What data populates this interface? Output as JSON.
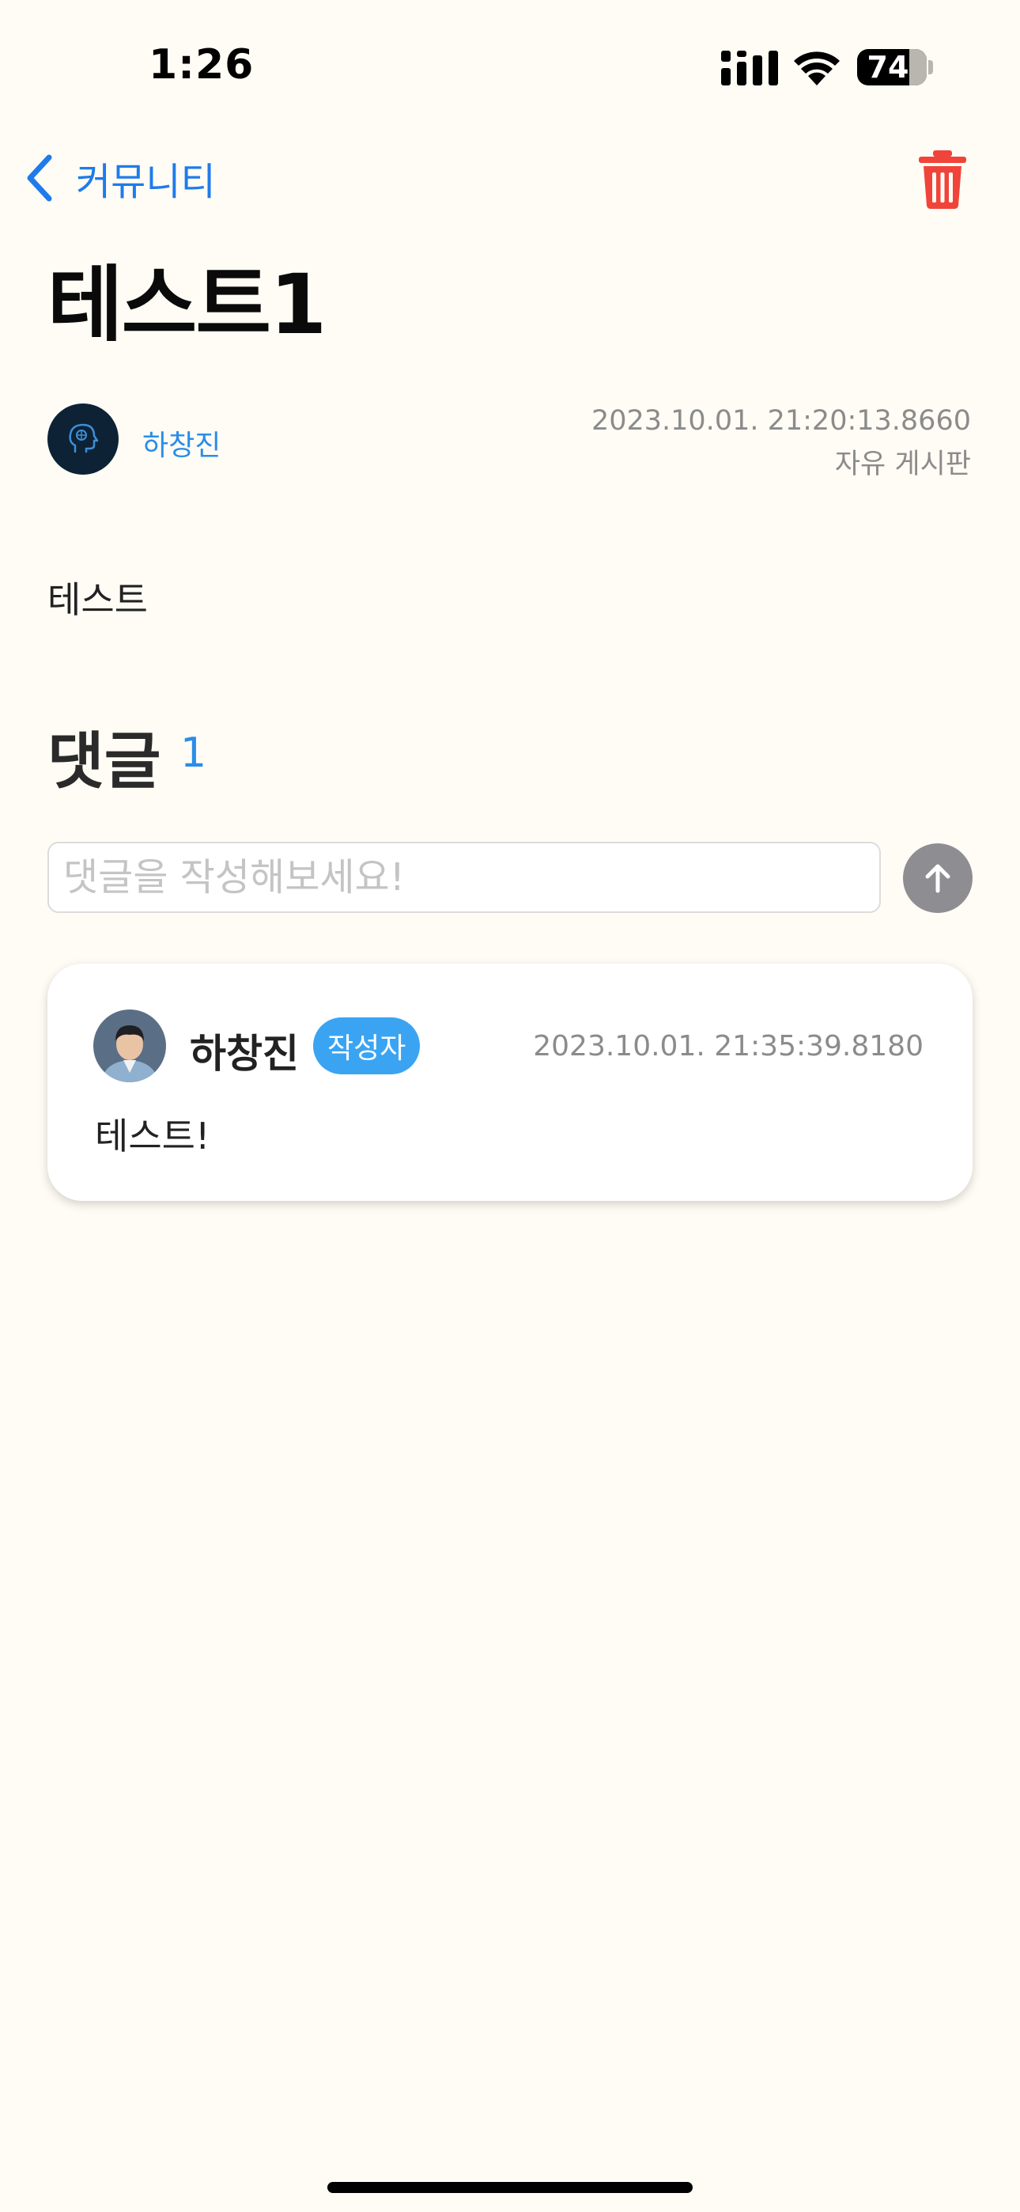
{
  "status_bar": {
    "time": "1:26",
    "battery_level": "74",
    "icons": [
      "cellular-signal-icon",
      "wifi-icon",
      "battery-icon"
    ]
  },
  "nav": {
    "back_label": "커뮤니티",
    "back_icon": "chevron-left-icon",
    "trash_icon": "trash-icon",
    "accent_color": "#1f7bea",
    "trash_color": "#f0443a"
  },
  "post": {
    "title": "테스트1",
    "author": "하창진",
    "date": "2023.10.01. 21:20:13.8660",
    "board": "자유 게시판",
    "body": "테스트"
  },
  "comments": {
    "title": "댓글",
    "count": "1",
    "input_placeholder": "댓글을 작성해보세요!",
    "send_icon": "arrow-up-icon",
    "items": [
      {
        "author": "하창진",
        "badge": "작성자",
        "date": "2023.10.01. 21:35:39.8180",
        "text": "테스트!"
      }
    ]
  }
}
